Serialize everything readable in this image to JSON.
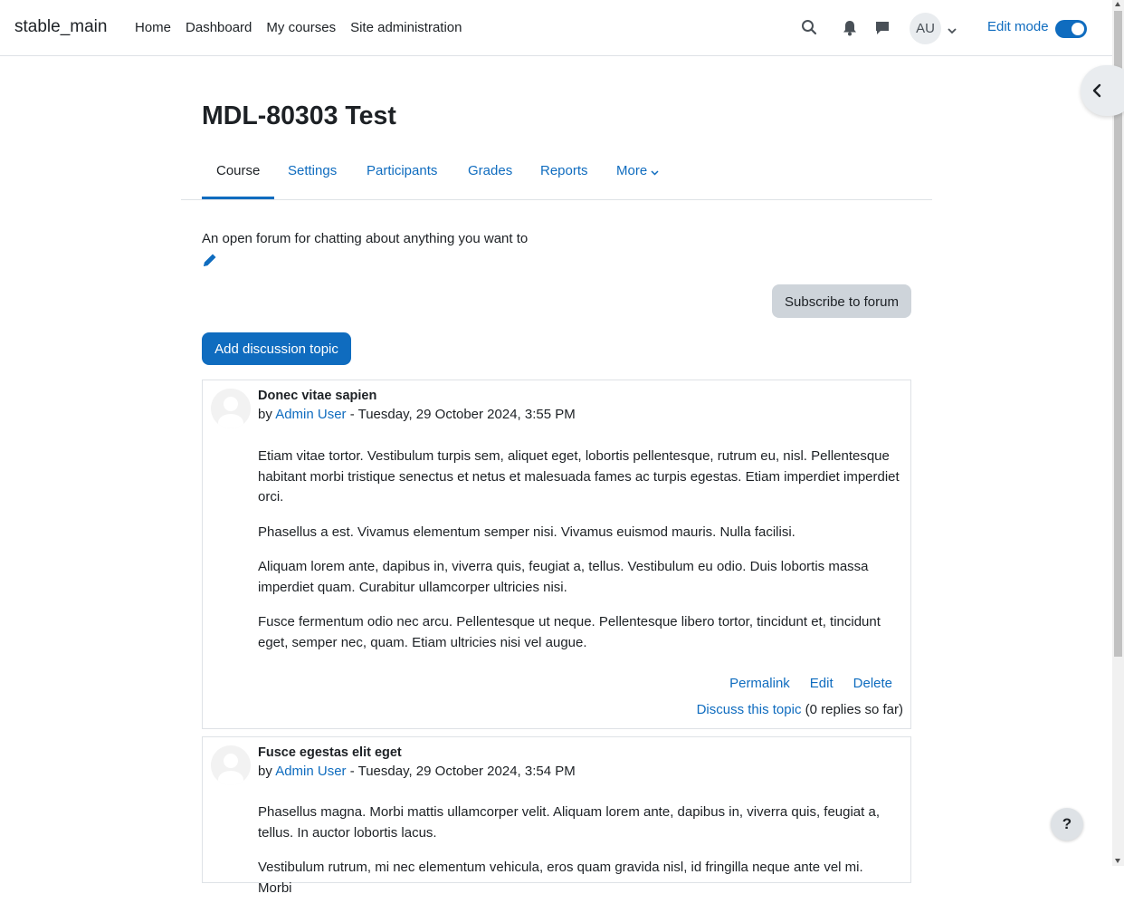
{
  "site": {
    "name": "stable_main"
  },
  "primary_nav": [
    {
      "label": "Home"
    },
    {
      "label": "Dashboard"
    },
    {
      "label": "My courses"
    },
    {
      "label": "Site administration"
    }
  ],
  "user": {
    "initials": "AU"
  },
  "edit_mode": {
    "label": "Edit mode",
    "enabled": true
  },
  "page": {
    "title": "MDL-80303 Test",
    "tabs": [
      {
        "label": "Course",
        "active": true
      },
      {
        "label": "Settings"
      },
      {
        "label": "Participants"
      },
      {
        "label": "Grades"
      },
      {
        "label": "Reports"
      },
      {
        "label": "More"
      }
    ],
    "intro": "An open forum for chatting about anything you want to"
  },
  "forum": {
    "subscribe_label": "Subscribe to forum",
    "add_topic_label": "Add discussion topic",
    "posts": [
      {
        "subject": "Donec vitae sapien",
        "by": "by ",
        "author": "Admin User",
        "date": " - Tuesday, 29 October 2024, 3:55 PM",
        "paragraphs": [
          "Etiam vitae tortor. Vestibulum turpis sem, aliquet eget, lobortis pellentesque, rutrum eu, nisl. Pellentesque habitant morbi tristique senectus et netus et malesuada fames ac turpis egestas. Etiam imperdiet imperdiet orci.",
          "Phasellus a est. Vivamus elementum semper nisi. Vivamus euismod mauris. Nulla facilisi.",
          "Aliquam lorem ante, dapibus in, viverra quis, feugiat a, tellus. Vestibulum eu odio. Duis lobortis massa imperdiet quam. Curabitur ullamcorper ultricies nisi.",
          "Fusce fermentum odio nec arcu. Pellentesque ut neque. Pellentesque libero tortor, tincidunt et, tincidunt eget, semper nec, quam. Etiam ultricies nisi vel augue."
        ],
        "actions": {
          "permalink": "Permalink",
          "edit": "Edit",
          "delete": "Delete"
        },
        "discuss": "Discuss this topic",
        "replies": "(0 replies so far)"
      },
      {
        "subject": "Fusce egestas elit eget",
        "by": "by ",
        "author": "Admin User",
        "date": " - Tuesday, 29 October 2024, 3:54 PM",
        "paragraphs": [
          "Phasellus magna. Morbi mattis ullamcorper velit. Aliquam lorem ante, dapibus in, viverra quis, feugiat a, tellus. In auctor lobortis lacus.",
          "Vestibulum rutrum, mi nec elementum vehicula, eros quam gravida nisl, id fringilla neque ante vel mi. Morbi"
        ]
      }
    ]
  },
  "help": {
    "label": "?"
  }
}
